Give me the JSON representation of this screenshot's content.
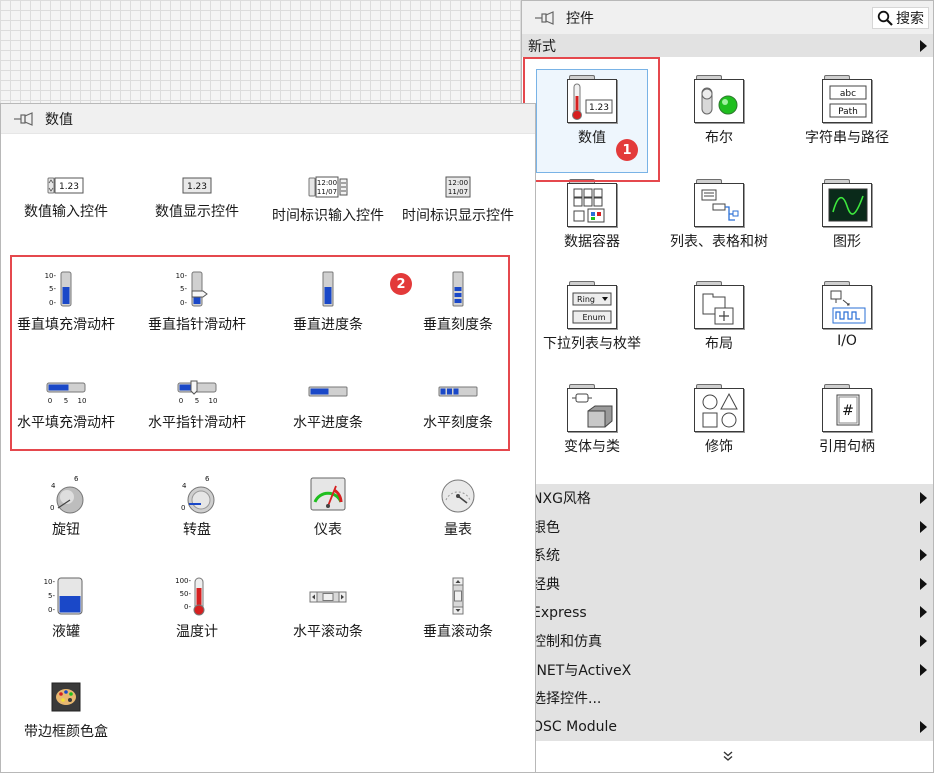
{
  "controls_palette": {
    "title": "控件",
    "search_label": "搜索",
    "section_label": "新式",
    "grid_items": [
      {
        "label": "数值"
      },
      {
        "label": "布尔"
      },
      {
        "label": "字符串与路径"
      },
      {
        "label": "数据容器"
      },
      {
        "label": "列表、表格和树"
      },
      {
        "label": "图形"
      },
      {
        "label": "下拉列表与枚举"
      },
      {
        "label": "布局"
      },
      {
        "label": "I/O"
      },
      {
        "label": "变体与类"
      },
      {
        "label": "修饰"
      },
      {
        "label": "引用句柄"
      }
    ],
    "subpalettes": [
      {
        "label": "NXG风格"
      },
      {
        "label": "银色"
      },
      {
        "label": "系统"
      },
      {
        "label": "经典"
      },
      {
        "label": "Express"
      },
      {
        "label": "控制和仿真"
      },
      {
        "label": ".NET与ActiveX"
      },
      {
        "label": "选择控件..."
      },
      {
        "label": "OSC Module"
      }
    ],
    "badge_number": "1"
  },
  "numeric_palette": {
    "title": "数值",
    "items": [
      {
        "label": "数值输入控件"
      },
      {
        "label": "数值显示控件"
      },
      {
        "label": "时间标识输入控件"
      },
      {
        "label": "时间标识显示控件"
      },
      {
        "label": "垂直填充滑动杆"
      },
      {
        "label": "垂直指针滑动杆"
      },
      {
        "label": "垂直进度条"
      },
      {
        "label": "垂直刻度条"
      },
      {
        "label": "水平填充滑动杆"
      },
      {
        "label": "水平指针滑动杆"
      },
      {
        "label": "水平进度条"
      },
      {
        "label": "水平刻度条"
      },
      {
        "label": "旋钮"
      },
      {
        "label": "转盘"
      },
      {
        "label": "仪表"
      },
      {
        "label": "量表"
      },
      {
        "label": "液罐"
      },
      {
        "label": "温度计"
      },
      {
        "label": "水平滚动条"
      },
      {
        "label": "垂直滚动条"
      },
      {
        "label": "带边框颜色盒"
      }
    ],
    "badge_number": "2",
    "icon_text": {
      "numeric_value": "1.23",
      "time_line1": "12:00",
      "time_line2": "11/07",
      "vscale_top": "10-",
      "vscale_mid": "5-",
      "vscale_bot": "0-",
      "hscale_0": "0",
      "hscale_5": "5",
      "hscale_10": "10",
      "knob_0": "0",
      "knob_4": "4",
      "knob_6": "6",
      "tank_10": "10-",
      "tank_5": "5-",
      "tank_0": "0-",
      "thermo_100": "100-",
      "thermo_50": "50-",
      "thermo_0": "0-",
      "cp_abc": "abc",
      "cp_path": "Path",
      "cp_ring": "Ring",
      "cp_enum": "Enum",
      "cp_hash": "#",
      "cp_array": "1 2 3 4"
    }
  },
  "colors": {
    "accent_red": "#e33a3a",
    "selection_blue": "#79b3e6",
    "led_green": "#1fbf1f",
    "bar_blue": "#1a48c8",
    "thermo_red": "#d62020"
  }
}
